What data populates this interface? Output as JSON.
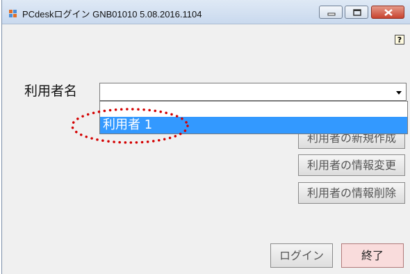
{
  "window": {
    "title": "PCdeskログイン GNB01010  5.08.2016.1104",
    "help_symbol": "?"
  },
  "form": {
    "user_label": "利用者名",
    "user_combo_value": "",
    "dropdown_options": [
      "利用者 1"
    ],
    "selected_option": "利用者 1"
  },
  "buttons": {
    "new_user": "利用者の新規作成",
    "edit_user": "利用者の情報変更",
    "delete_user": "利用者の情報削除",
    "login": "ログイン",
    "exit": "終了"
  },
  "colors": {
    "selection": "#3399ff",
    "annotation": "#d40000",
    "exit_button": "#f9dcdc"
  }
}
